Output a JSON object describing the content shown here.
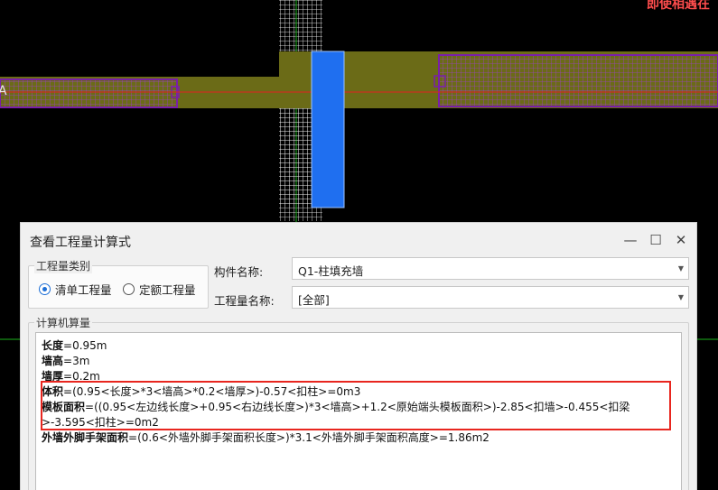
{
  "canvas": {
    "cad_text": "即使相遇在",
    "axis_label": "A"
  },
  "dialog": {
    "title": "查看工程量计算式",
    "controls": {
      "minimize_icon": "minimize-icon",
      "maximize_icon": "maximize-icon",
      "close_icon": "close-icon"
    },
    "category_group": {
      "legend": "工程量类别",
      "options": [
        {
          "label": "清单工程量",
          "checked": true
        },
        {
          "label": "定额工程量",
          "checked": false
        }
      ]
    },
    "component_name": {
      "label": "构件名称:",
      "value": "Q1-柱填充墙"
    },
    "quantity_name": {
      "label": "工程量名称:",
      "value": "[全部]"
    },
    "computer_calc": {
      "legend": "计算机算量",
      "lines": [
        {
          "name": "长度",
          "formula": "=0.95m"
        },
        {
          "name": "墙高",
          "formula": "=3m"
        },
        {
          "name": "墙厚",
          "formula": "=0.2m"
        },
        {
          "name": "体积",
          "formula": "=(0.95<长度>*3<墙高>*0.2<墙厚>)-0.57<扣柱>=0m3"
        },
        {
          "name": "模板面积",
          "formula": "=((0.95<左边线长度>+0.95<右边线长度>)*3<墙高>+1.2<原始端头模板面积>)-2.85<扣墙>-0.455<扣梁>-3.595<扣柱>=0m2"
        },
        {
          "name": "外墙外脚手架面积",
          "formula": "=(0.6<外墙外脚手架面积长度>)*3.1<外墙外脚手架面积高度>=1.86m2"
        }
      ]
    }
  },
  "colors": {
    "wall_fill": "#6b6b17",
    "wall_outline": "#7a1fa8",
    "column_fill": "#1f6ff0",
    "axis_line": "#e02020",
    "grid": "#ffffff",
    "highlight": "#e8261f",
    "radio_accent": "#1e6fd6"
  }
}
